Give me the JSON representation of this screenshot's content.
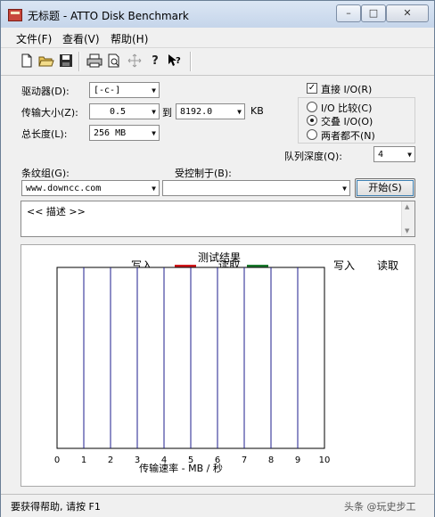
{
  "window": {
    "title": "无标题 - ATTO Disk Benchmark"
  },
  "window_controls": {
    "minimize": "–",
    "maximize": "□",
    "close": "✕"
  },
  "menu": [
    "文件(F)",
    "查看(V)",
    "帮助(H)"
  ],
  "toolbar_icons": [
    "new-file-icon",
    "open-folder-icon",
    "save-icon",
    "print-icon",
    "print-preview-icon",
    "move-icon",
    "help-icon",
    "context-help-icon"
  ],
  "form": {
    "drive_label": "驱动器(D):",
    "drive_value": "[-c-]",
    "transfer_label": "传输大小(Z):",
    "transfer_from": "0.5",
    "to_label": "到",
    "transfer_to": "8192.0",
    "kb_label": "KB",
    "total_label": "总长度(L):",
    "total_value": "256 MB",
    "direct_io_label": "直接 I/O(R)",
    "direct_io_checked": true,
    "radio_io_compare": "I/O 比较(C)",
    "radio_overlap": "交叠 I/O(O)",
    "radio_neither": "两者都不(N)",
    "radio_selected": "overlap",
    "queue_label": "队列深度(Q):",
    "queue_value": "4",
    "stripe_label": "条纹组(G):",
    "stripe_value": "www.downcc.com",
    "controlled_label": "受控制于(B):",
    "controlled_value": "",
    "start_button": "开始(S)",
    "description": "<< 描述 >>"
  },
  "results": {
    "title": "测试结果",
    "write_legend": "写入",
    "read_legend": "读取",
    "write_color": "#d0191b",
    "read_color": "#1b7a2e",
    "col_write": "写入",
    "col_read": "读取",
    "x_axis_label": "传输速率 - MB / 秒"
  },
  "chart_data": {
    "type": "bar",
    "title": "测试结果",
    "xlabel": "传输速率 - MB / 秒",
    "ylabel": "",
    "xlim": [
      0,
      10
    ],
    "x_ticks": [
      "0",
      "1",
      "2",
      "3",
      "4",
      "5",
      "6",
      "7",
      "8",
      "9",
      "10"
    ],
    "categories": [],
    "series": [
      {
        "name": "写入",
        "values": []
      },
      {
        "name": "读取",
        "values": []
      }
    ],
    "legend": "top"
  },
  "status": {
    "text": "要获得帮助, 请按 F1",
    "watermark": "头条 @玩史步工"
  }
}
